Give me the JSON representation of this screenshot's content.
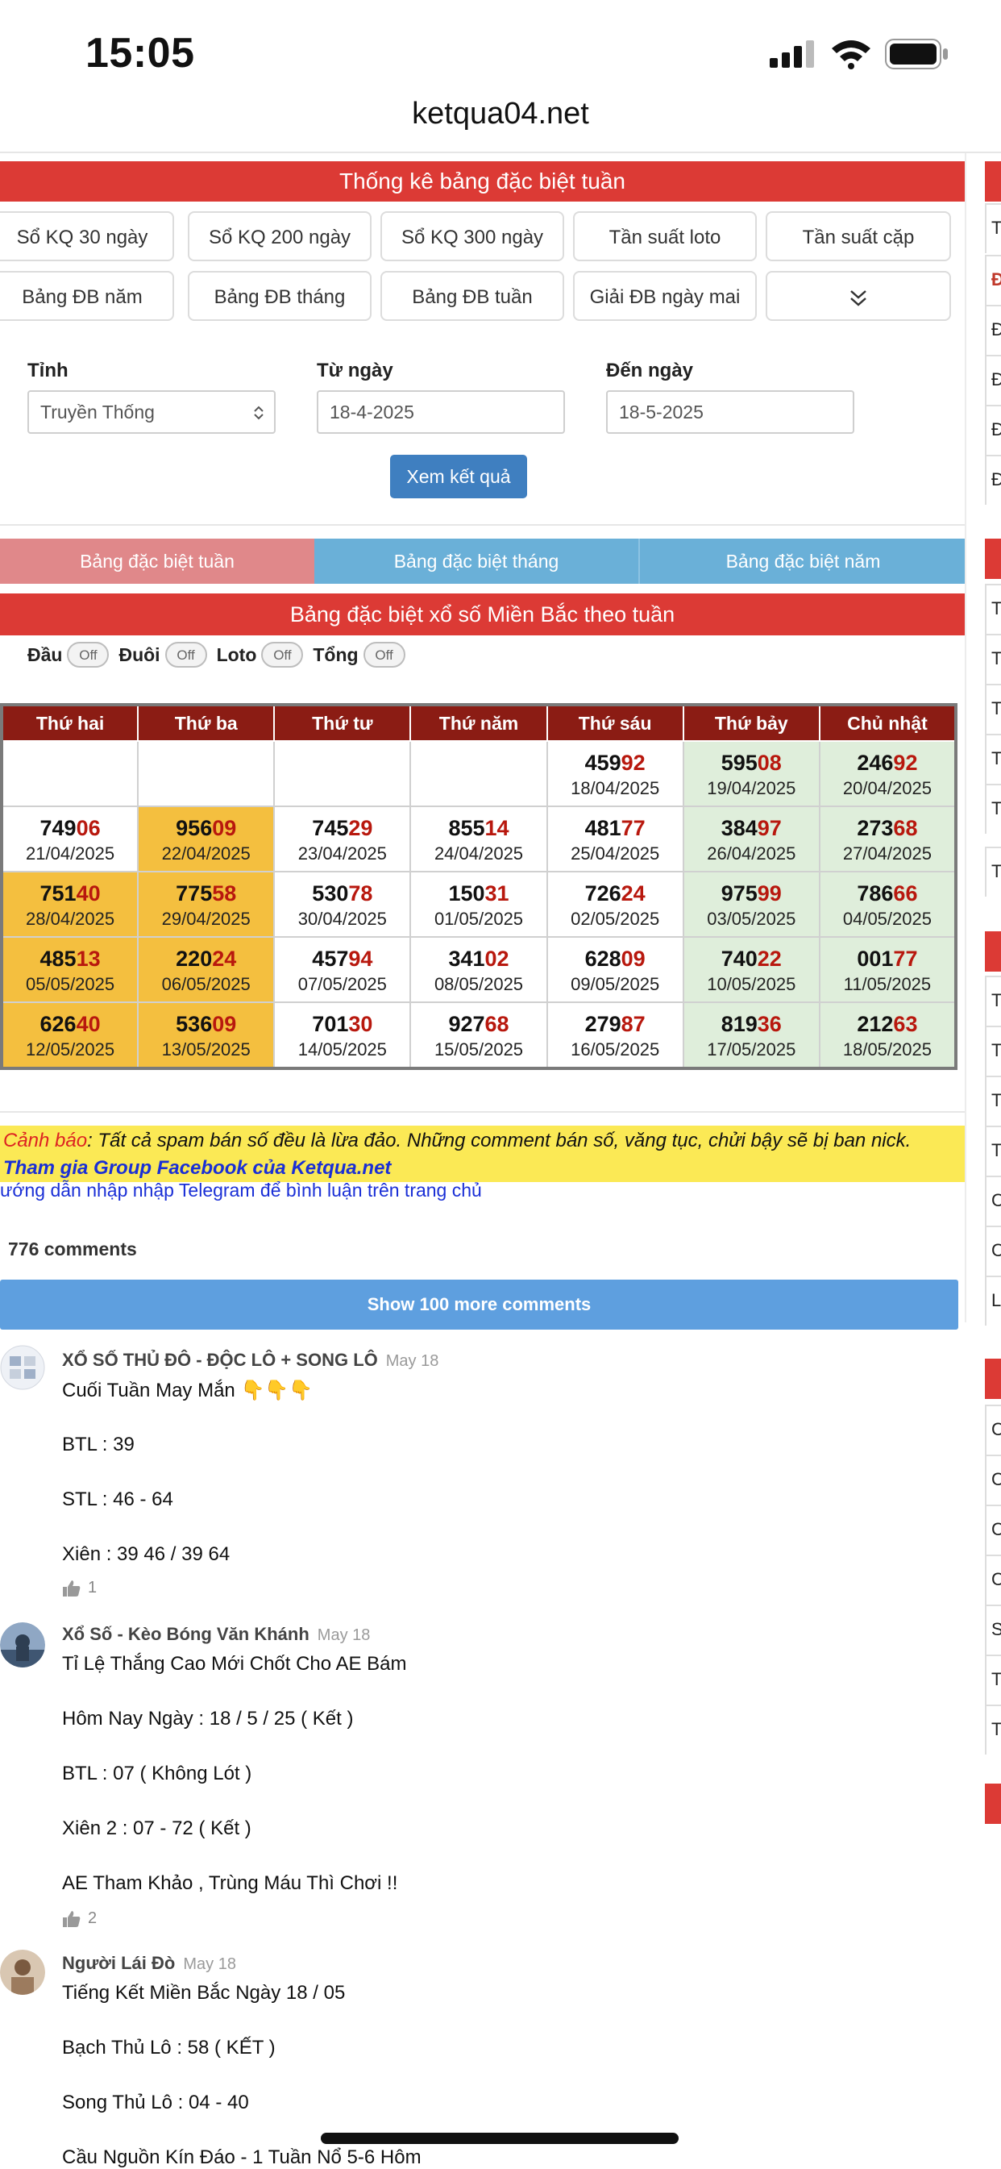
{
  "status_bar": {
    "time": "15:05"
  },
  "browser": {
    "url": "ketqua04.net"
  },
  "header": {
    "title": "Thống kê bảng đặc biệt tuần"
  },
  "nav_buttons": [
    [
      "Sổ KQ 30 ngày",
      "Sổ KQ 200 ngày",
      "Sổ KQ 300 ngày",
      "Tần suất loto",
      "Tần suất cặp"
    ],
    [
      "Bảng ĐB năm",
      "Bảng ĐB tháng",
      "Bảng ĐB tuần",
      "Giải ĐB ngày mai",
      ""
    ]
  ],
  "filter": {
    "province_label": "Tỉnh",
    "province_value": "Truyền Thống",
    "from_label": "Từ ngày",
    "from_value": "18-4-2025",
    "to_label": "Đến ngày",
    "to_value": "18-5-2025",
    "submit_label": "Xem kết quả"
  },
  "sub_tabs": [
    "Bảng đặc biệt tuần",
    "Bảng đặc biệt tháng",
    "Bảng đặc biệt năm"
  ],
  "table_title": "Bảng đặc biệt xổ số Miền Bắc theo tuần",
  "toggles": [
    {
      "label": "Đầu",
      "state": "Off"
    },
    {
      "label": "Đuôi",
      "state": "Off"
    },
    {
      "label": "Loto",
      "state": "Off"
    },
    {
      "label": "Tổng",
      "state": "Off"
    }
  ],
  "weekdays": [
    "Thứ hai",
    "Thứ ba",
    "Thứ tư",
    "Thứ năm",
    "Thứ sáu",
    "Thứ bảy",
    "Chủ nhật"
  ],
  "weeks": [
    [
      null,
      null,
      null,
      null,
      {
        "head": "459",
        "tail": "92",
        "date": "18/04/2025"
      },
      {
        "head": "595",
        "tail": "08",
        "date": "19/04/2025"
      },
      {
        "head": "246",
        "tail": "92",
        "date": "20/04/2025"
      }
    ],
    [
      {
        "head": "749",
        "tail": "06",
        "date": "21/04/2025"
      },
      {
        "head": "956",
        "tail": "09",
        "date": "22/04/2025",
        "hl": true
      },
      {
        "head": "745",
        "tail": "29",
        "date": "23/04/2025"
      },
      {
        "head": "855",
        "tail": "14",
        "date": "24/04/2025"
      },
      {
        "head": "481",
        "tail": "77",
        "date": "25/04/2025"
      },
      {
        "head": "384",
        "tail": "97",
        "date": "26/04/2025"
      },
      {
        "head": "273",
        "tail": "68",
        "date": "27/04/2025"
      }
    ],
    [
      {
        "head": "751",
        "tail": "40",
        "date": "28/04/2025",
        "hl": true
      },
      {
        "head": "775",
        "tail": "58",
        "date": "29/04/2025",
        "hl": true
      },
      {
        "head": "530",
        "tail": "78",
        "date": "30/04/2025"
      },
      {
        "head": "150",
        "tail": "31",
        "date": "01/05/2025"
      },
      {
        "head": "726",
        "tail": "24",
        "date": "02/05/2025"
      },
      {
        "head": "975",
        "tail": "99",
        "date": "03/05/2025"
      },
      {
        "head": "786",
        "tail": "66",
        "date": "04/05/2025"
      }
    ],
    [
      {
        "head": "485",
        "tail": "13",
        "date": "05/05/2025",
        "hl": true
      },
      {
        "head": "220",
        "tail": "24",
        "date": "06/05/2025",
        "hl": true
      },
      {
        "head": "457",
        "tail": "94",
        "date": "07/05/2025"
      },
      {
        "head": "341",
        "tail": "02",
        "date": "08/05/2025"
      },
      {
        "head": "628",
        "tail": "09",
        "date": "09/05/2025"
      },
      {
        "head": "740",
        "tail": "22",
        "date": "10/05/2025"
      },
      {
        "head": "001",
        "tail": "77",
        "date": "11/05/2025"
      }
    ],
    [
      {
        "head": "626",
        "tail": "40",
        "date": "12/05/2025",
        "hl": true
      },
      {
        "head": "536",
        "tail": "09",
        "date": "13/05/2025",
        "hl": true
      },
      {
        "head": "701",
        "tail": "30",
        "date": "14/05/2025"
      },
      {
        "head": "927",
        "tail": "68",
        "date": "15/05/2025"
      },
      {
        "head": "279",
        "tail": "87",
        "date": "16/05/2025"
      },
      {
        "head": "819",
        "tail": "36",
        "date": "17/05/2025"
      },
      {
        "head": "212",
        "tail": "63",
        "date": "18/05/2025"
      }
    ]
  ],
  "warning": {
    "prefix": "Cảnh báo",
    "text": ": Tất cả spam bán số đều là lừa đảo. Những comment bán số, văng tục, chửi bậy sẽ bị ban nick.",
    "facebook": "Tham gia Group Facebook của Ketqua.net",
    "telegram": "ướng dẫn nhập nhập Telegram để bình luận trên trang chủ"
  },
  "comments": {
    "count_label": "776 comments",
    "show_more": "Show 100 more comments",
    "items": [
      {
        "author": "XỔ SỐ THỦ ĐÔ - ĐỘC LÔ + SONG LÔ",
        "date": "May 18",
        "lines": [
          "Cuối Tuần May Mắn 👇👇👇",
          "BTL : 39",
          "STL : 46 - 64",
          "Xiên : 39 46 / 39 64"
        ],
        "likes": "1"
      },
      {
        "author": "Xổ Số - Kèo Bóng Văn Khánh",
        "date": "May 18",
        "lines": [
          "Tỉ Lệ Thắng Cao Mới Chốt Cho AE Bám",
          "Hôm Nay Ngày :  18 / 5 / 25 ( Kết )",
          "BTL : 07 ( Không Lót )",
          "Xiên 2 : 07 - 72 ( Kết )",
          "AE Tham Khảo , Trùng Máu Thì Chơi !!"
        ],
        "likes": "2"
      },
      {
        "author": "Người Lái Đò",
        "date": "May 18",
        "lines": [
          "Tiếng Kết Miền Bắc Ngày 18 / 05",
          "Bạch Thủ Lô : 58 ( KẾT )",
          "Song Thủ Lô : 04 - 40",
          "Cầu Nguồn Kín Đáo - 1 Tuần Nổ 5-6 Hôm"
        ],
        "likes": ""
      }
    ]
  },
  "sidebar_fragments": [
    "T",
    "Đ",
    "Đ",
    "Đ",
    "Đ",
    "Đ",
    "T",
    "T",
    "T",
    "T",
    "T",
    "T",
    "T",
    "T",
    "T",
    "T",
    "C",
    "C",
    "L",
    "C",
    "C",
    "C",
    "C",
    "S",
    "T",
    "T"
  ],
  "colors": {
    "header_red": "#dc3a35",
    "table_head": "#8b1c14",
    "highlight": "#f4bf3f",
    "weekend": "#dfeedb",
    "tail_red": "#b8180e",
    "link_blue": "#1a2fd6",
    "tab_active": "#e0888a",
    "tab_inactive": "#6ab0d8"
  }
}
